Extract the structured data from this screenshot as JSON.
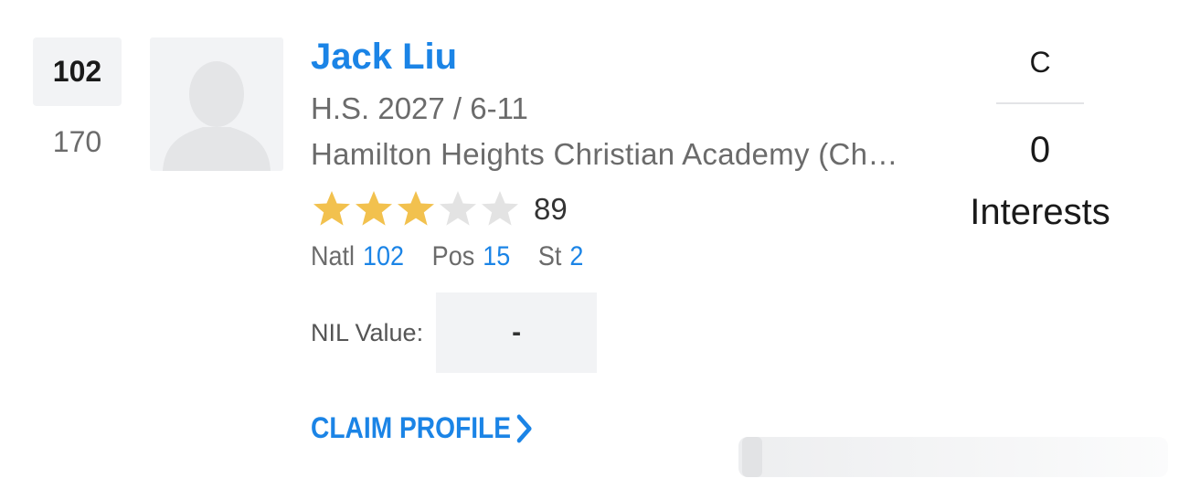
{
  "player": {
    "rank": "102",
    "previous_rank": "170",
    "name": "Jack Liu",
    "class_height": "H.S. 2027 / 6-11",
    "school": "Hamilton Heights Christian Academy (Chattanooga, TN)",
    "stars": 3,
    "max_stars": 5,
    "rating": "89",
    "star_color": "#f2c14e",
    "star_empty_color": "#e3e3e3",
    "avatar_icon": "person-silhouette-icon"
  },
  "rankings": [
    {
      "label": "Natl",
      "value": "102"
    },
    {
      "label": "Pos",
      "value": "15"
    },
    {
      "label": "St",
      "value": "2"
    }
  ],
  "nil": {
    "label": "NIL Value:",
    "value": "-"
  },
  "claim": {
    "label": "CLAIM PROFILE",
    "icon": "chevron-right-icon"
  },
  "position_info": {
    "position": "C",
    "interest_count": "0",
    "interest_label": "Interests"
  },
  "colors": {
    "accent": "#1b84e6",
    "muted_text": "#6b6b6b",
    "panel_bg": "#f2f3f5"
  }
}
